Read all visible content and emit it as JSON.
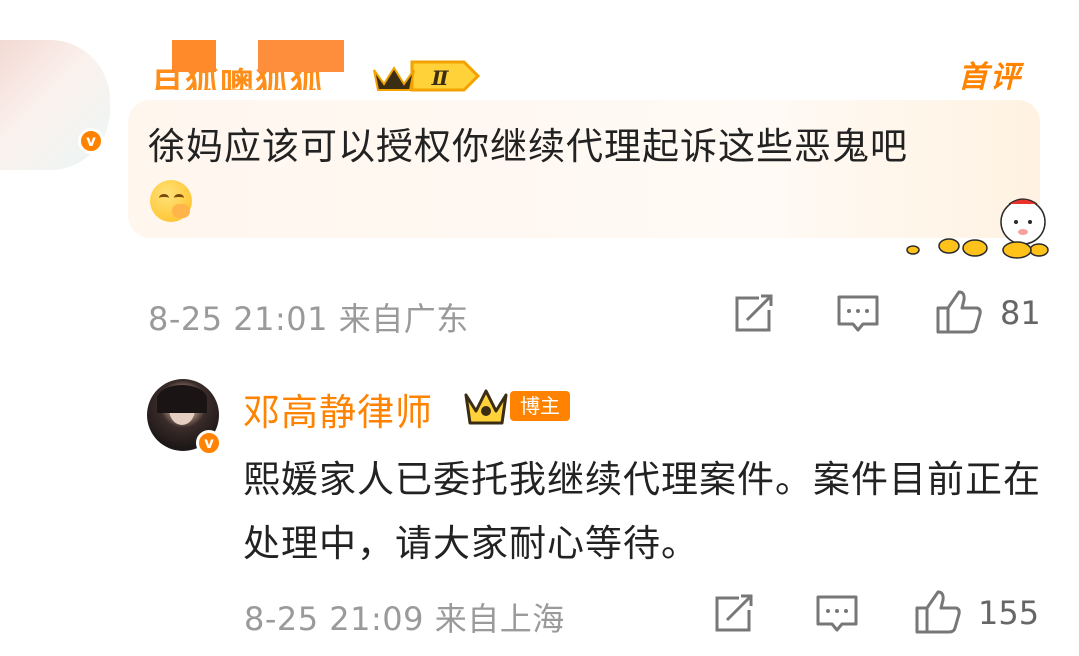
{
  "comment": {
    "username": "月狐噢狐狐",
    "top_label": "首评",
    "level_badge": "Ⅱ",
    "text": "徐妈应该可以授权你继续代理起诉这些恶鬼吧",
    "emoji": "thinking-face",
    "date": "8-25",
    "time": "21:01",
    "location": "来自广东",
    "likes": "81"
  },
  "reply": {
    "username": "邓高静律师",
    "tag": "博主",
    "text": "熙媛家人已委托我继续代理案件。案件目前正在处理中，请大家耐心等待。",
    "date": "8-25",
    "time": "21:09",
    "location": "来自上海",
    "likes": "155"
  },
  "colors": {
    "accent": "#ff8200",
    "meta_text": "#9a9a9a",
    "bubble_bg": "#fff6ee"
  },
  "icons": {
    "verify": "v",
    "repost": "repost-icon",
    "comment": "comment-icon",
    "like": "thumbs-up-icon"
  }
}
